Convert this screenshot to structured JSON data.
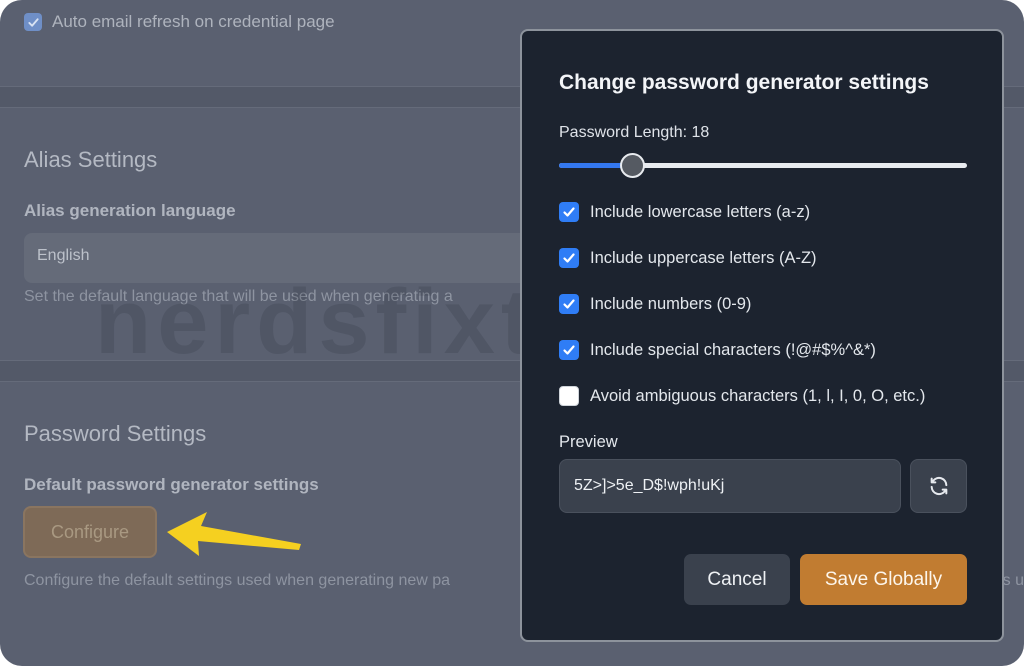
{
  "background": {
    "auto_refresh_label": "Auto email refresh on credential page",
    "alias_section_title": "Alias Settings",
    "alias_language_label": "Alias generation language",
    "alias_language_value": "English",
    "alias_language_hint": "Set the default language that will be used when generating a",
    "password_section_title": "Password Settings",
    "password_default_label": "Default password generator settings",
    "configure_button_label": "Configure",
    "password_hint": "Configure the default settings used when generating new pa",
    "password_hint_tail": "s u",
    "watermark_text": "nerdsfixthat.com"
  },
  "modal": {
    "title": "Change password generator settings",
    "length_label": "Password Length: 18",
    "length": {
      "value": 18,
      "min": 8,
      "max": 64
    },
    "options": [
      {
        "label": "Include lowercase letters (a-z)",
        "checked": true
      },
      {
        "label": "Include uppercase letters (A-Z)",
        "checked": true
      },
      {
        "label": "Include numbers (0-9)",
        "checked": true
      },
      {
        "label": "Include special characters (!@#$%^&*)",
        "checked": true
      },
      {
        "label": "Avoid ambiguous characters (1, l, I, 0, O, etc.)",
        "checked": false
      }
    ],
    "preview_label": "Preview",
    "preview_value": "5Z>]>5e_D$!wph!uKj",
    "refresh_icon": "refresh-icon",
    "cancel_label": "Cancel",
    "save_label": "Save Globally"
  },
  "colors": {
    "accent": "#2f7df6",
    "save": "#c17c31",
    "modal_bg": "#1c232f",
    "annotation_arrow": "#f5d020"
  }
}
